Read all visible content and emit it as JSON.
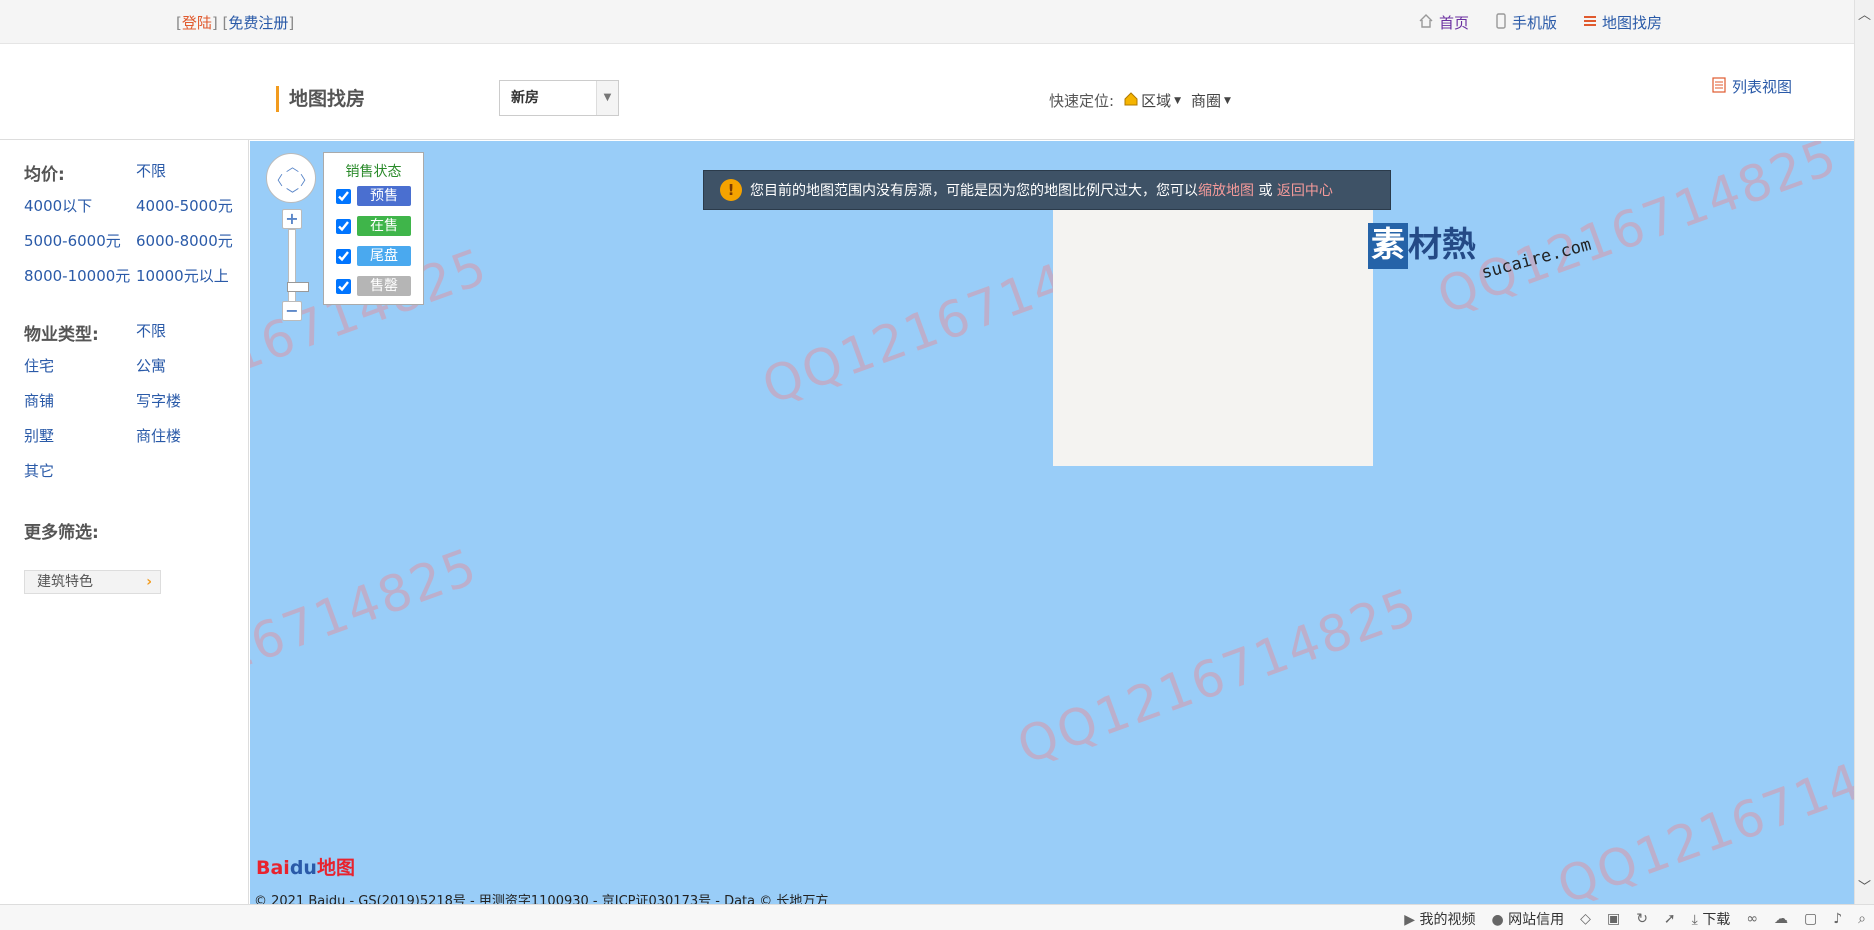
{
  "topbar": {
    "login": "登陆",
    "register": "免费注册",
    "links": [
      {
        "label": "首页",
        "icon": "home-icon"
      },
      {
        "label": "手机版",
        "icon": "mobile-icon"
      },
      {
        "label": "地图找房",
        "icon": "menu-icon"
      }
    ]
  },
  "header": {
    "title": "地图找房",
    "select_value": "新房",
    "quick_label": "快速定位:",
    "quick_area": "区域",
    "quick_circle": "商圈",
    "list_view": "列表视图"
  },
  "sidebar": {
    "price_label": "均价:",
    "price_options": [
      "不限",
      "4000以下",
      "4000-5000元",
      "5000-6000元",
      "6000-8000元",
      "8000-10000元",
      "10000元以上"
    ],
    "type_label": "物业类型:",
    "type_options": [
      "不限",
      "住宅",
      "公寓",
      "商铺",
      "写字楼",
      "别墅",
      "商住楼",
      "其它"
    ],
    "more_label": "更多筛选:",
    "feature_button": "建筑特色"
  },
  "map": {
    "legend_title": "销售状态",
    "legend_items": [
      {
        "label": "预售",
        "color": "#4a6fd0",
        "checked": true
      },
      {
        "label": "在售",
        "color": "#3fb54a",
        "checked": true
      },
      {
        "label": "尾盘",
        "color": "#4aa9ef",
        "checked": true
      },
      {
        "label": "售罄",
        "color": "#b5b5b5",
        "checked": true
      }
    ],
    "notice_text": "您目前的地图范围内没有房源，可能是因为您的地图比例尺过大，您可以",
    "notice_zoom": "缩放地图",
    "notice_or": "或",
    "notice_center": "返回中心",
    "brand_char": "素",
    "brand_rest": "材熱",
    "brand_domain": "sucaire.com",
    "watermark": "QQ1216714825",
    "baidu_text": "Bai",
    "baidu_paw": "du",
    "baidu_map": "地图",
    "copyright": "© 2021 Baidu - GS(2019)5218号 - 甲测资字1100930 - 京ICP证030173号 - Data © 长地万方"
  },
  "statusbar": {
    "items": [
      "我的视频",
      "网站信用",
      "下载"
    ]
  },
  "colors": {
    "map_bg": "#99cdf8",
    "link": "#2a5aa8",
    "accent": "#f29b1e"
  }
}
